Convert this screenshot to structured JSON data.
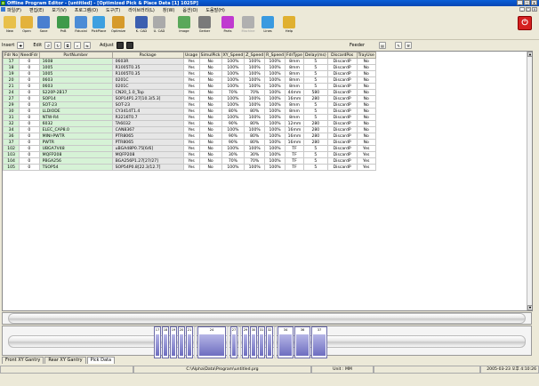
{
  "window": {
    "title": "Offline Program Editor - [untitled] - [Optimized Pick & Place Data [1] 1025P]",
    "controls": [
      "_",
      "□",
      "×"
    ]
  },
  "menu": [
    "파일(F)",
    "편집(E)",
    "보기(V)",
    "프로그램(O)",
    "도구(T)",
    "라이브러리(L)",
    "창(W)",
    "옵션(O)",
    "도움말(H)"
  ],
  "toolbar": [
    {
      "label": "New",
      "icon": "new-icon",
      "color": "#e8c04a"
    },
    {
      "label": "Open",
      "icon": "open-icon",
      "color": "#e3b23c"
    },
    {
      "label": "Save",
      "icon": "save-icon",
      "color": "#4a7fd0"
    },
    {
      "label": "PnB",
      "icon": "pnb-icon",
      "color": "#3f9a4a"
    },
    {
      "label": "Fiducial",
      "icon": "fiducial-icon",
      "color": "#4c8cd6"
    },
    {
      "label": "PickPlace",
      "icon": "pickplace-icon",
      "color": "#3ea0e0"
    },
    {
      "label": "Optimize",
      "icon": "optimize-icon",
      "color": "#d69a2a"
    },
    {
      "label": "K. CAD",
      "icon": "kcad-icon",
      "color": "#3c5fb0"
    },
    {
      "label": "U. CAD",
      "icon": "ucad-icon",
      "color": "#aaaaaa"
    },
    {
      "label": "Image",
      "icon": "image-icon",
      "color": "#5aa85a"
    },
    {
      "label": "Gerber",
      "icon": "gerber-icon",
      "color": "#7a7a7a"
    },
    {
      "label": "Parts",
      "icon": "parts-icon",
      "color": "#c03ad0"
    },
    {
      "label": "Machine",
      "icon": "machine-icon",
      "color": "#b0b0b0",
      "disabled": true
    },
    {
      "label": "Lines",
      "icon": "lines-icon",
      "color": "#3a9ae0"
    },
    {
      "label": "Help",
      "icon": "help-icon",
      "color": "#e0b030"
    }
  ],
  "subtoolbar": {
    "insert": "Insert",
    "edit": "Edit",
    "adjust": "Adjust",
    "feeder": "Feeder"
  },
  "table": {
    "columns": [
      "Fdr No",
      "NeedFdr",
      "PartNumber",
      "Package",
      "Usage",
      "SimulPick",
      "XY_Speed",
      "Z_Speed",
      "R_Speed",
      "FdrType",
      "Delay(ms)",
      "DiscardPos",
      "TrayUse"
    ],
    "rows": [
      [
        "17",
        "0",
        "1608",
        "0603R",
        "Yes",
        "No",
        "100%",
        "100%",
        "100%",
        "8mm",
        "5",
        "DiscardP",
        "No"
      ],
      [
        "18",
        "0",
        "1005",
        "R1005T0.35",
        "Yes",
        "No",
        "100%",
        "100%",
        "100%",
        "8mm",
        "5",
        "DiscardP",
        "No"
      ],
      [
        "19",
        "0",
        "1005",
        "R1005T0.35",
        "Yes",
        "No",
        "100%",
        "100%",
        "100%",
        "8mm",
        "5",
        "DiscardP",
        "No"
      ],
      [
        "20",
        "0",
        "0603",
        "0201C",
        "Yes",
        "No",
        "100%",
        "100%",
        "100%",
        "8mm",
        "5",
        "DiscardP",
        "No"
      ],
      [
        "21",
        "0",
        "0603",
        "0201C",
        "Yes",
        "No",
        "100%",
        "100%",
        "100%",
        "8mm",
        "5",
        "DiscardP",
        "No"
      ],
      [
        "24",
        "0",
        "S220P-2B17",
        "CN20_1.0_Top",
        "Yes",
        "No",
        "70%",
        "70%",
        "100%",
        "44mm",
        "580",
        "DiscardP",
        "No"
      ],
      [
        "27",
        "0",
        "SOP14",
        "SOP14P1.27[10.3/5.3]",
        "Yes",
        "No",
        "100%",
        "100%",
        "100%",
        "16mm",
        "280",
        "DiscardP",
        "No"
      ],
      [
        "29",
        "0",
        "SOT-23",
        "SOT-23",
        "Yes",
        "No",
        "100%",
        "100%",
        "100%",
        "8mm",
        "5",
        "DiscardP",
        "No"
      ],
      [
        "30",
        "0",
        "LLDIODE",
        "CY3414T1.4",
        "Yes",
        "No",
        "80%",
        "80%",
        "100%",
        "8mm",
        "5",
        "DiscardP",
        "No"
      ],
      [
        "31",
        "0",
        "NTW-R4",
        "R3216T0.7",
        "Yes",
        "No",
        "100%",
        "100%",
        "100%",
        "8mm",
        "5",
        "DiscardP",
        "No"
      ],
      [
        "32",
        "0",
        "6032",
        "TA6032",
        "Yes",
        "No",
        "90%",
        "80%",
        "100%",
        "12mm",
        "280",
        "DiscardP",
        "No"
      ],
      [
        "34",
        "0",
        "ELEC_CAP8.0",
        "CAN8367",
        "Yes",
        "No",
        "100%",
        "100%",
        "100%",
        "16mm",
        "280",
        "DiscardP",
        "No"
      ],
      [
        "36",
        "0",
        "MINI-PWTR",
        "PTR8065",
        "Yes",
        "No",
        "90%",
        "80%",
        "100%",
        "16mm",
        "280",
        "DiscardP",
        "No"
      ],
      [
        "37",
        "0",
        "PWTR",
        "PTR8065",
        "Yes",
        "No",
        "90%",
        "80%",
        "100%",
        "16mm",
        "280",
        "DiscardP",
        "No"
      ],
      [
        "102",
        "0",
        "UBGA7V48",
        "uBGA48P0.75[6/6]",
        "Yes",
        "No",
        "100%",
        "100%",
        "100%",
        "TF",
        "5",
        "DiscardP",
        "Yes"
      ],
      [
        "103",
        "0",
        "MQFP208",
        "MQFP208",
        "Yes",
        "No",
        "30%",
        "30%",
        "100%",
        "TF",
        "5",
        "DiscardP",
        "Yes"
      ],
      [
        "104",
        "0",
        "PBGA256",
        "BGA256P1.27[27/27]",
        "Yes",
        "No",
        "70%",
        "70%",
        "100%",
        "TF",
        "5",
        "DiscardP",
        "Yes"
      ],
      [
        "105",
        "0",
        "TSOP54",
        "SOP54P0.8[22.3/12.7]",
        "Yes",
        "No",
        "100%",
        "100%",
        "100%",
        "TF",
        "5",
        "DiscardP",
        "Yes"
      ]
    ]
  },
  "feeders": [
    "17",
    "18",
    "19",
    "20",
    "21",
    "24",
    "27",
    "29",
    "30",
    "31",
    "32",
    "34",
    "36",
    "37"
  ],
  "tabs": [
    {
      "label": "Front XY Gantry",
      "active": false
    },
    {
      "label": "Rear XY Gantry",
      "active": false
    },
    {
      "label": "Pick Data",
      "active": true
    }
  ],
  "status": {
    "path": "C:\\Alpha\\Data\\Program\\untitled.prg",
    "unit": "Unit : MM",
    "datetime": "2005-03-23 오후 4:10:26"
  }
}
